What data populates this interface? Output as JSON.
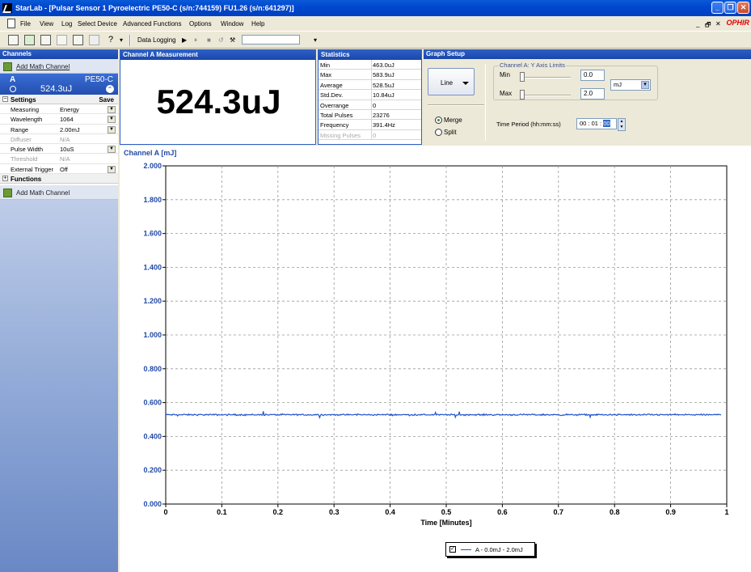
{
  "window": {
    "title": "StarLab - [Pulsar Sensor 1 Pyroelectric PE50-C (s/n:744159)  FU1.26 (s/n:641297)]",
    "minimize": "_",
    "restore": "❐",
    "close": "✕",
    "child_minimize": "_",
    "child_restore": "🗗",
    "child_close": "✕",
    "logo": "OPHIR"
  },
  "menu": [
    "File",
    "View",
    "Log",
    "Select Device",
    "Advanced Functions",
    "Options",
    "Window",
    "Help"
  ],
  "toolbar": {
    "data_logging_label": "Data Logging",
    "play": "▶",
    "pause": "⏸",
    "stop": "■",
    "dropdown": "▾"
  },
  "left_panel": {
    "header": "Channels",
    "add_math_channel_top": "Add Math Channel",
    "channel": {
      "letter": "A",
      "sensor": "PE50-C",
      "reading": "524.3uJ",
      "collapse_glyph": "⌃"
    },
    "settings_header": "Settings",
    "save_label": "Save",
    "settings": [
      {
        "key": "Measuring",
        "value": "Energy",
        "dropdown": true,
        "disabled": false
      },
      {
        "key": "Wavelength",
        "value": "1064",
        "dropdown": true,
        "disabled": false
      },
      {
        "key": "Range",
        "value": "2.00mJ",
        "dropdown": true,
        "disabled": false
      },
      {
        "key": "Diffuser",
        "value": "N/A",
        "dropdown": false,
        "disabled": true
      },
      {
        "key": "Pulse Width",
        "value": "10uS",
        "dropdown": true,
        "disabled": false
      },
      {
        "key": "Threshold",
        "value": "N/A",
        "dropdown": false,
        "disabled": true
      },
      {
        "key": "External Trigger",
        "value": "Off",
        "dropdown": true,
        "disabled": false
      }
    ],
    "functions_header": "Functions",
    "add_math_channel_bottom": "Add Math Channel",
    "minus": "−",
    "plus": "+"
  },
  "measurement": {
    "header": "Channel A Measurement",
    "value": "524.3uJ"
  },
  "statistics": {
    "header": "Statistics",
    "rows": [
      {
        "key": "Min",
        "value": "463.0uJ",
        "disabled": false
      },
      {
        "key": "Max",
        "value": "583.9uJ",
        "disabled": false
      },
      {
        "key": "Average",
        "value": "528.5uJ",
        "disabled": false
      },
      {
        "key": "Std.Dev.",
        "value": "10.84uJ",
        "disabled": false
      },
      {
        "key": "Overrange",
        "value": "0",
        "disabled": false
      },
      {
        "key": "Total Pulses",
        "value": "23276",
        "disabled": false
      },
      {
        "key": "Frequency",
        "value": "391.4Hz",
        "disabled": false
      },
      {
        "key": "Missing Pulses",
        "value": "0",
        "disabled": true
      }
    ]
  },
  "graph_setup": {
    "header": "Graph Setup",
    "graph_type": "Line",
    "merge_label": "Merge",
    "split_label": "Split",
    "selected_mode": "Merge",
    "y_axis_group_title": "Channel A: Y Axis Limits",
    "min_label": "Min",
    "min_value": "0.0",
    "max_label": "Max",
    "max_value": "2.0",
    "unit": "mJ",
    "time_period_label": "Time Period (hh:mm:ss)",
    "time_period_prefix": "00 : 01 :",
    "time_period_seconds": "00"
  },
  "chart_data": {
    "type": "line",
    "title": "Channel A [mJ]",
    "xlabel": "Time [Minutes]",
    "ylabel": "",
    "xlim": [
      0,
      1
    ],
    "ylim": [
      0,
      2
    ],
    "x_ticks": [
      "0",
      "0.1",
      "0.2",
      "0.3",
      "0.4",
      "0.5",
      "0.6",
      "0.7",
      "0.8",
      "0.9",
      "1"
    ],
    "y_ticks": [
      "0.000",
      "0.200",
      "0.400",
      "0.600",
      "0.800",
      "1.000",
      "1.200",
      "1.400",
      "1.600",
      "1.800",
      "2.000"
    ],
    "grid": true,
    "legend_position": "bottom-center",
    "series": [
      {
        "name": "A - 0.0mJ - 2.0mJ",
        "color": "#2255cc",
        "x_range": [
          0,
          0.99
        ],
        "mean": 0.528,
        "min": 0.463,
        "max": 0.584
      }
    ]
  }
}
